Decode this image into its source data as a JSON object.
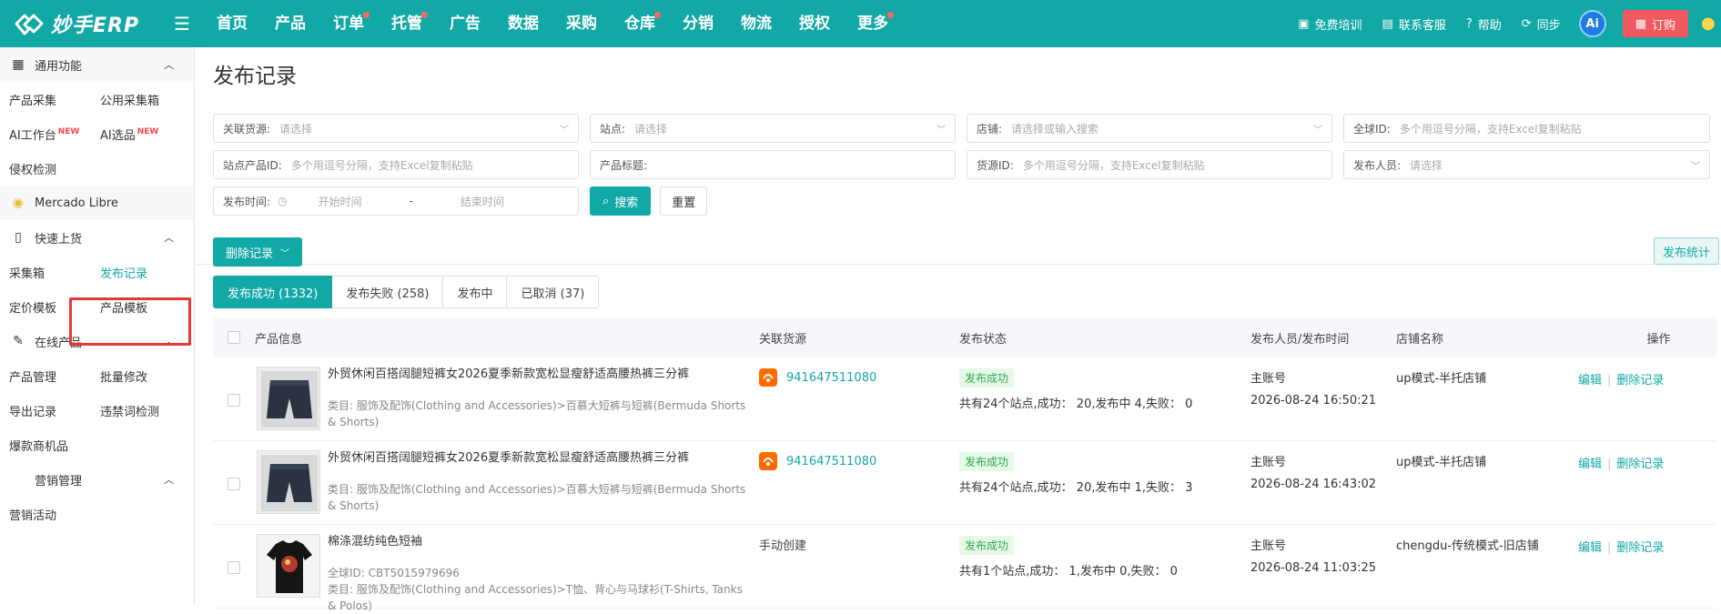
{
  "brand": {
    "name": "妙手ERP"
  },
  "nav": [
    {
      "label": "首页",
      "dot": false
    },
    {
      "label": "产品",
      "dot": false
    },
    {
      "label": "订单",
      "dot": true
    },
    {
      "label": "托管",
      "dot": true
    },
    {
      "label": "广告",
      "dot": false
    },
    {
      "label": "数据",
      "dot": false
    },
    {
      "label": "采购",
      "dot": false
    },
    {
      "label": "仓库",
      "dot": true
    },
    {
      "label": "分销",
      "dot": false
    },
    {
      "label": "物流",
      "dot": false
    },
    {
      "label": "授权",
      "dot": false
    },
    {
      "label": "更多",
      "dot": true
    }
  ],
  "topright": {
    "training": "免费培训",
    "support": "联系客服",
    "help": "帮助",
    "sync": "同步",
    "ai": "Ai",
    "order": "订购"
  },
  "sidebar": {
    "group_common": "通用功能",
    "item_collect": "产品采集",
    "item_public_box": "公用采集箱",
    "item_ai_workbench": "AI工作台",
    "item_ai_select": "AI选品",
    "new_tag": "NEW",
    "item_infringe": "侵权检测",
    "group_mercado": "Mercado Libre",
    "group_quick": "快速上货",
    "item_box": "采集箱",
    "item_publish_log": "发布记录",
    "item_price_tpl": "定价模板",
    "item_product_tpl": "产品模板",
    "group_online": "在线产品",
    "item_manage": "产品管理",
    "item_batch": "批量修改",
    "item_export": "导出记录",
    "item_banned": "违禁词检测",
    "item_hot": "爆款商机品",
    "group_marketing": "营销管理",
    "item_activity": "营销活动"
  },
  "page": {
    "title": "发布记录"
  },
  "filters": {
    "source_label": "关联货源:",
    "source_ph": "请选择",
    "site_label": "站点:",
    "site_ph": "请选择",
    "shop_label": "店铺:",
    "shop_ph": "请选择或输入搜索",
    "gid_label": "全球ID:",
    "gid_ph": "多个用逗号分隔，支持Excel复制粘贴",
    "spid_label": "站点产品ID:",
    "spid_ph": "多个用逗号分隔，支持Excel复制粘贴",
    "title_label": "产品标题:",
    "srcid_label": "货源ID:",
    "srcid_ph": "多个用逗号分隔，支持Excel复制粘贴",
    "publisher_label": "发布人员:",
    "publisher_ph": "请选择",
    "time_label": "发布时间:",
    "start_ph": "开始时间",
    "dash": "-",
    "end_ph": "结束时间",
    "search_btn": "搜索",
    "reset_btn": "重置"
  },
  "actions": {
    "delete_btn": "删除记录",
    "stats_btn": "发布统计"
  },
  "tabs": [
    {
      "label": "发布成功 (1332)",
      "active": true
    },
    {
      "label": "发布失败 (258)",
      "active": false
    },
    {
      "label": "发布中",
      "active": false
    },
    {
      "label": "已取消 (37)",
      "active": false
    }
  ],
  "table": {
    "headers": {
      "product": "产品信息",
      "source": "关联货源",
      "status": "发布状态",
      "publisher": "发布人员/发布时间",
      "shop": "店铺名称",
      "ops": "操作"
    },
    "rows": [
      {
        "title": "外贸休闲百搭阔腿短裤女2026夏季新款宽松显瘦舒适高腰热裤三分裤",
        "gid": "",
        "category": "类目: 服饰及配饰(Clothing and Accessories)>百慕大短裤与短裤(Bermuda Shorts & Shorts)",
        "source": "941647511080",
        "source_link": true,
        "status": "发布成功",
        "detail": "共有24个站点,成功： 20,发布中 4,失败： 0",
        "publisher": "主账号",
        "time": "2026-08-24 16:50:21",
        "shop": "up模式-半托店铺",
        "edit": "编辑",
        "delete": "删除记录",
        "thumb": "shorts"
      },
      {
        "title": "外贸休闲百搭阔腿短裤女2026夏季新款宽松显瘦舒适高腰热裤三分裤",
        "gid": "",
        "category": "类目: 服饰及配饰(Clothing and Accessories)>百慕大短裤与短裤(Bermuda Shorts & Shorts)",
        "source": "941647511080",
        "source_link": true,
        "status": "发布成功",
        "detail": "共有24个站点,成功： 20,发布中 1,失败： 3",
        "publisher": "主账号",
        "time": "2026-08-24 16:43:02",
        "shop": "up模式-半托店铺",
        "edit": "编辑",
        "delete": "删除记录",
        "thumb": "shorts"
      },
      {
        "title": "棉涤混纺纯色短袖",
        "gid": "全球ID: CBT5015979696",
        "category": "类目: 服饰及配饰(Clothing and Accessories)>T恤、背心与马球衫(T-Shirts, Tanks & Polos)",
        "source": "手动创建",
        "source_link": false,
        "status": "发布成功",
        "detail": "共有1个站点,成功： 1,发布中 0,失败： 0",
        "publisher": "主账号",
        "time": "2026-08-24 11:03:25",
        "shop": "chengdu-传统模式-旧店铺",
        "edit": "编辑",
        "delete": "删除记录",
        "thumb": "tshirt"
      }
    ]
  },
  "colors": {
    "brand": "#12a8a6",
    "danger": "#f0595f",
    "success": "#2fa84f"
  }
}
